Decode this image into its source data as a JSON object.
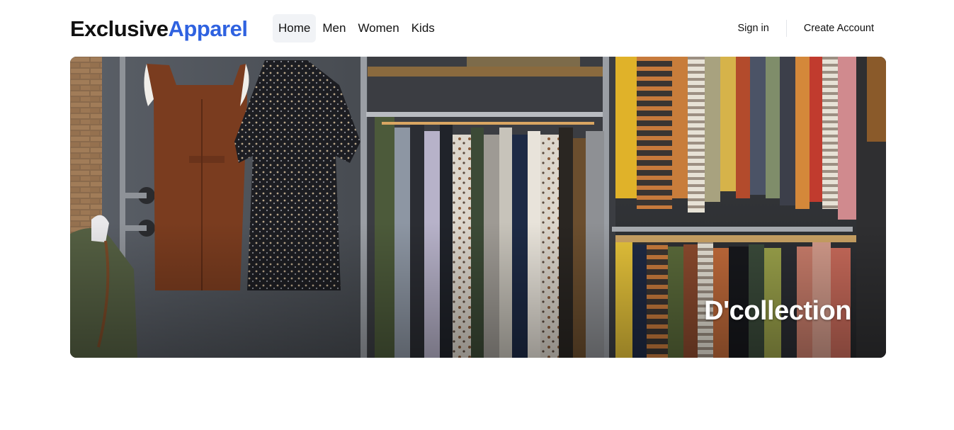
{
  "brand": {
    "part1": "Exclusive",
    "part2": "Apparel",
    "accent_color": "#2f62e0"
  },
  "nav": {
    "items": [
      {
        "label": "Home",
        "active": true
      },
      {
        "label": "Men",
        "active": false
      },
      {
        "label": "Women",
        "active": false
      },
      {
        "label": "Kids",
        "active": false
      }
    ]
  },
  "auth": {
    "sign_in": "Sign in",
    "create_account": "Create Account"
  },
  "hero": {
    "title": "D'collection"
  }
}
